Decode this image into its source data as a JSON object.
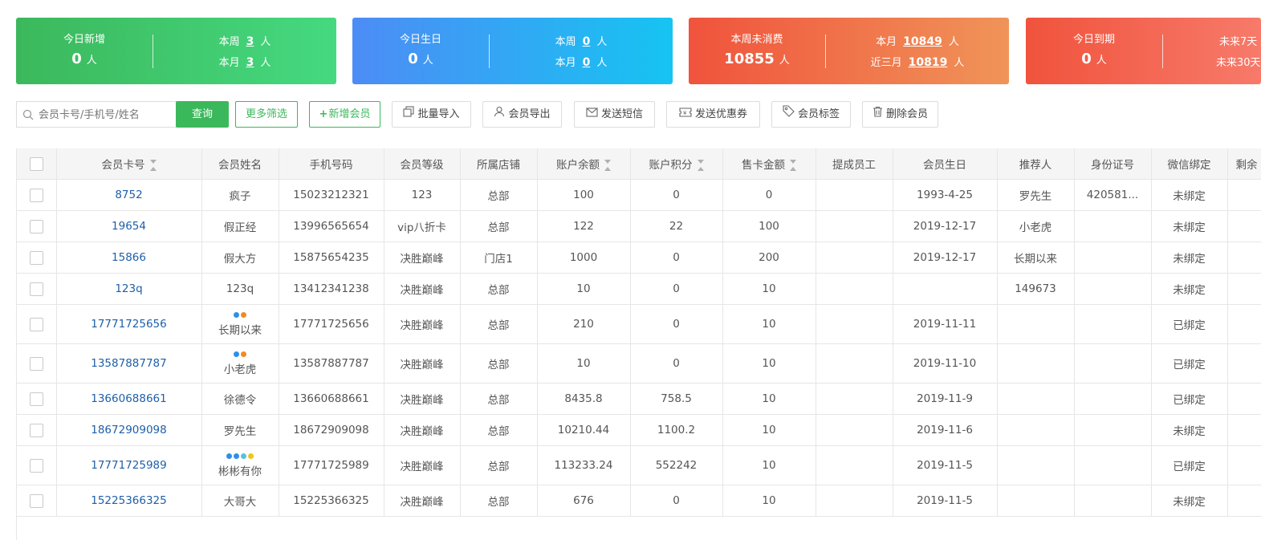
{
  "stats": [
    {
      "title": "今日新增",
      "value": "0",
      "unit": "人",
      "rows": [
        {
          "label": "本周",
          "value": "3",
          "unit": "人"
        },
        {
          "label": "本月",
          "value": "3",
          "unit": "人"
        }
      ]
    },
    {
      "title": "今日生日",
      "value": "0",
      "unit": "人",
      "rows": [
        {
          "label": "本周",
          "value": "0",
          "unit": "人"
        },
        {
          "label": "本月",
          "value": "0",
          "unit": "人"
        }
      ]
    },
    {
      "title": "本周未消费",
      "value": "10855",
      "unit": "人",
      "rows": [
        {
          "label": "本月",
          "value": "10849",
          "unit": "人"
        },
        {
          "label": "近三月",
          "value": "10819",
          "unit": "人"
        }
      ]
    },
    {
      "title": "今日到期",
      "value": "0",
      "unit": "人",
      "rows": [
        {
          "label": "未来7天",
          "value": "",
          "unit": ""
        },
        {
          "label": "未来30天",
          "value": "",
          "unit": ""
        }
      ]
    }
  ],
  "colors": {
    "card1": [
      "#3cb85c",
      "#45d980"
    ],
    "card2": [
      "#4d8cf5",
      "#16c4f2"
    ],
    "card3": [
      "#f0533c",
      "#f09459"
    ],
    "card4": [
      "#f0533c",
      "#f77a6a"
    ],
    "primary": "#3cb85c",
    "link": "#1e5fa8"
  },
  "toolbar": {
    "search_placeholder": "会员卡号/手机号/姓名",
    "query": "查询",
    "more_filter": "更多筛选",
    "add_member": "新增会员",
    "batch_import": "批量导入",
    "export": "会员导出",
    "send_sms": "发送短信",
    "send_coupon": "发送优惠券",
    "member_tag": "会员标签",
    "delete_member": "删除会员"
  },
  "table": {
    "headers": {
      "card_no": "会员卡号",
      "name": "会员姓名",
      "phone": "手机号码",
      "level": "会员等级",
      "store": "所属店铺",
      "balance": "账户余额",
      "points": "账户积分",
      "sales": "售卡金额",
      "staff": "提成员工",
      "birthday": "会员生日",
      "referrer": "推荐人",
      "id_no": "身份证号",
      "wechat": "微信绑定",
      "remain": "剩余"
    },
    "rows": [
      {
        "card_no": "8752",
        "name": "疯子",
        "phone": "15023212321",
        "level": "123",
        "store": "总部",
        "balance": "100",
        "points": "0",
        "sales": "0",
        "staff": "",
        "birthday": "1993-4-25",
        "referrer": "罗先生",
        "id_no": "420581...",
        "wechat": "未绑定"
      },
      {
        "card_no": "19654",
        "name": "假正经",
        "phone": "13996565654",
        "level": "vip八折卡",
        "store": "总部",
        "balance": "122",
        "points": "22",
        "sales": "100",
        "staff": "",
        "birthday": "2019-12-17",
        "referrer": "小老虎",
        "id_no": "",
        "wechat": "未绑定"
      },
      {
        "card_no": "15866",
        "name": "假大方",
        "phone": "15875654235",
        "level": "决胜巅峰",
        "store": "门店1",
        "balance": "1000",
        "points": "0",
        "sales": "200",
        "staff": "",
        "birthday": "2019-12-17",
        "referrer": "长期以来",
        "id_no": "",
        "wechat": "未绑定"
      },
      {
        "card_no": "123q",
        "name": "123q",
        "phone": "13412341238",
        "level": "决胜巅峰",
        "store": "总部",
        "balance": "10",
        "points": "0",
        "sales": "10",
        "staff": "",
        "birthday": "",
        "referrer": "149673",
        "id_no": "",
        "wechat": "未绑定"
      },
      {
        "card_no": "17771725656",
        "name": "长期以来",
        "phone": "17771725656",
        "level": "决胜巅峰",
        "store": "总部",
        "balance": "210",
        "points": "0",
        "sales": "10",
        "staff": "",
        "birthday": "2019-11-11",
        "referrer": "",
        "id_no": "",
        "wechat": "已绑定",
        "tags": [
          "#2f8fe8",
          "#f08a24"
        ]
      },
      {
        "card_no": "13587887787",
        "name": "小老虎",
        "phone": "13587887787",
        "level": "决胜巅峰",
        "store": "总部",
        "balance": "10",
        "points": "0",
        "sales": "10",
        "staff": "",
        "birthday": "2019-11-10",
        "referrer": "",
        "id_no": "",
        "wechat": "已绑定",
        "tags": [
          "#2f8fe8",
          "#f08a24"
        ]
      },
      {
        "card_no": "13660688661",
        "name": "徐德令",
        "phone": "13660688661",
        "level": "决胜巅峰",
        "store": "总部",
        "balance": "8435.8",
        "points": "758.5",
        "sales": "10",
        "staff": "",
        "birthday": "2019-11-9",
        "referrer": "",
        "id_no": "",
        "wechat": "已绑定"
      },
      {
        "card_no": "18672909098",
        "name": "罗先生",
        "phone": "18672909098",
        "level": "决胜巅峰",
        "store": "总部",
        "balance": "10210.44",
        "points": "1100.2",
        "sales": "10",
        "staff": "",
        "birthday": "2019-11-6",
        "referrer": "",
        "id_no": "",
        "wechat": "未绑定"
      },
      {
        "card_no": "17771725989",
        "name": "彬彬有你",
        "phone": "17771725989",
        "level": "决胜巅峰",
        "store": "总部",
        "balance": "113233.24",
        "points": "552242",
        "sales": "10",
        "staff": "",
        "birthday": "2019-11-5",
        "referrer": "",
        "id_no": "",
        "wechat": "已绑定",
        "tags": [
          "#2f8fe8",
          "#2f8fe8",
          "#5bc0de",
          "#f0c419"
        ]
      },
      {
        "card_no": "15225366325",
        "name": "大哥大",
        "phone": "15225366325",
        "level": "决胜巅峰",
        "store": "总部",
        "balance": "676",
        "points": "0",
        "sales": "10",
        "staff": "",
        "birthday": "2019-11-5",
        "referrer": "",
        "id_no": "",
        "wechat": "未绑定"
      }
    ]
  }
}
